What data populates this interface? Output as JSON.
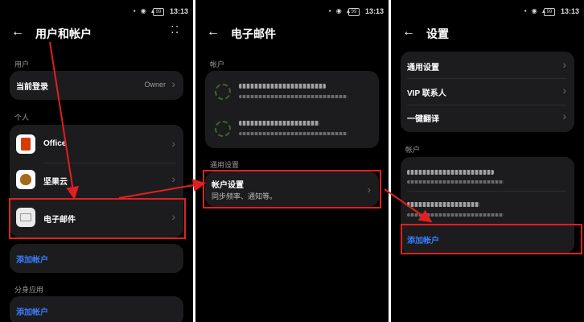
{
  "status_bar": {
    "time": "13:13",
    "battery": "99"
  },
  "screen1": {
    "title": "用户和帐户",
    "section_user": "用户",
    "current_login_label": "当前登录",
    "current_login_value": "Owner",
    "section_personal": "个人",
    "apps": [
      {
        "label": "Office",
        "icon": "office-icon"
      },
      {
        "label": "坚果云",
        "icon": "nut-cloud-icon"
      },
      {
        "label": "电子邮件",
        "icon": "mail-icon"
      }
    ],
    "add_account": "添加帐户",
    "section_clone": "分身应用",
    "add_account_2": "添加帐户"
  },
  "screen2": {
    "title": "电子邮件",
    "section_accounts": "帐户",
    "section_general": "通用设置",
    "account_settings_label": "帐户设置",
    "account_settings_sub": "同步频率、通知等。"
  },
  "screen3": {
    "title": "设置",
    "items": [
      "通用设置",
      "VIP 联系人",
      "一键翻译"
    ],
    "section_accounts": "帐户",
    "add_account": "添加帐户"
  },
  "colors": {
    "highlight": "#e02020",
    "link": "#3a7dff"
  }
}
